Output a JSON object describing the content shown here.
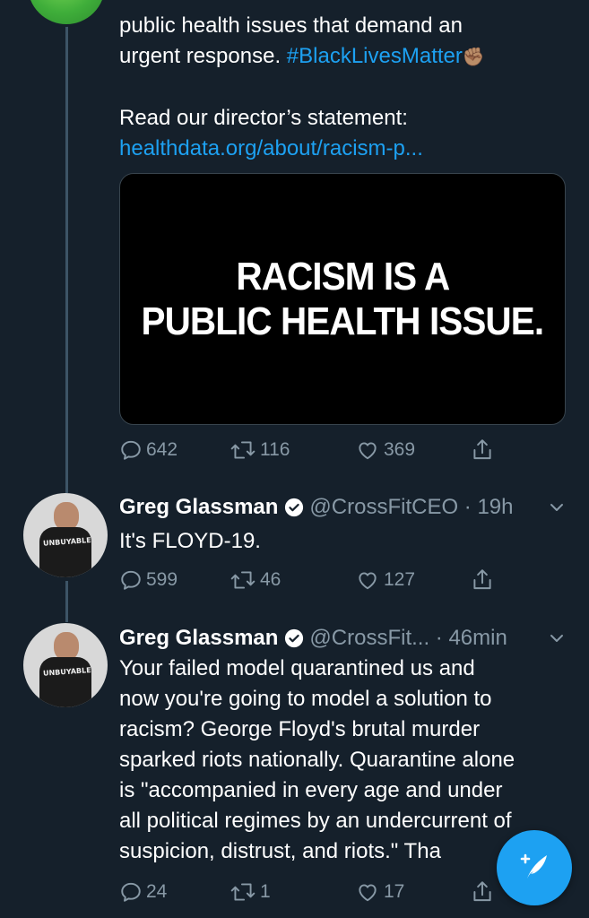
{
  "tweet1": {
    "text_line1": "public health issues that demand an",
    "text_line2_prefix": "urgent response. ",
    "hashtag": "#BlackLivesMatter",
    "emoji": "✊🏽",
    "read_line": "Read our director’s statement:",
    "link": "healthdata.org/about/racism-p...",
    "media_line1": "RACISM IS A",
    "media_line2": "PUBLIC HEALTH ISSUE.",
    "replies": "642",
    "retweets": "116",
    "likes": "369"
  },
  "tweet2": {
    "name": "Greg Glassman",
    "handle": "@CrossFitCEO · 19h",
    "text": "It's FLOYD-19.",
    "replies": "599",
    "retweets": "46",
    "likes": "127",
    "avatar_shirt_text": "UNBUYABLE"
  },
  "tweet3": {
    "name": "Greg Glassman",
    "handle": "@CrossFit... · 46min",
    "lines": [
      "Your failed model quarantined us and",
      "now you're going to model a solution to",
      "racism? George Floyd's brutal murder",
      "sparked riots nationally. Quarantine alone",
      "is \"accompanied in every age and under",
      "all political regimes by an undercurrent of",
      "suspicion, distrust, and riots.\" Tha"
    ],
    "replies": "24",
    "retweets": "1",
    "likes": "17",
    "avatar_shirt_text": "UNBUYABLE"
  },
  "icons": {
    "reply": "reply-icon",
    "retweet": "retweet-icon",
    "like": "like-icon",
    "share": "share-icon",
    "verified": "verified-badge-icon",
    "compose": "compose-tweet-icon"
  },
  "colors": {
    "background": "#15202b",
    "accent": "#1da1f2",
    "muted": "#8899a6"
  }
}
